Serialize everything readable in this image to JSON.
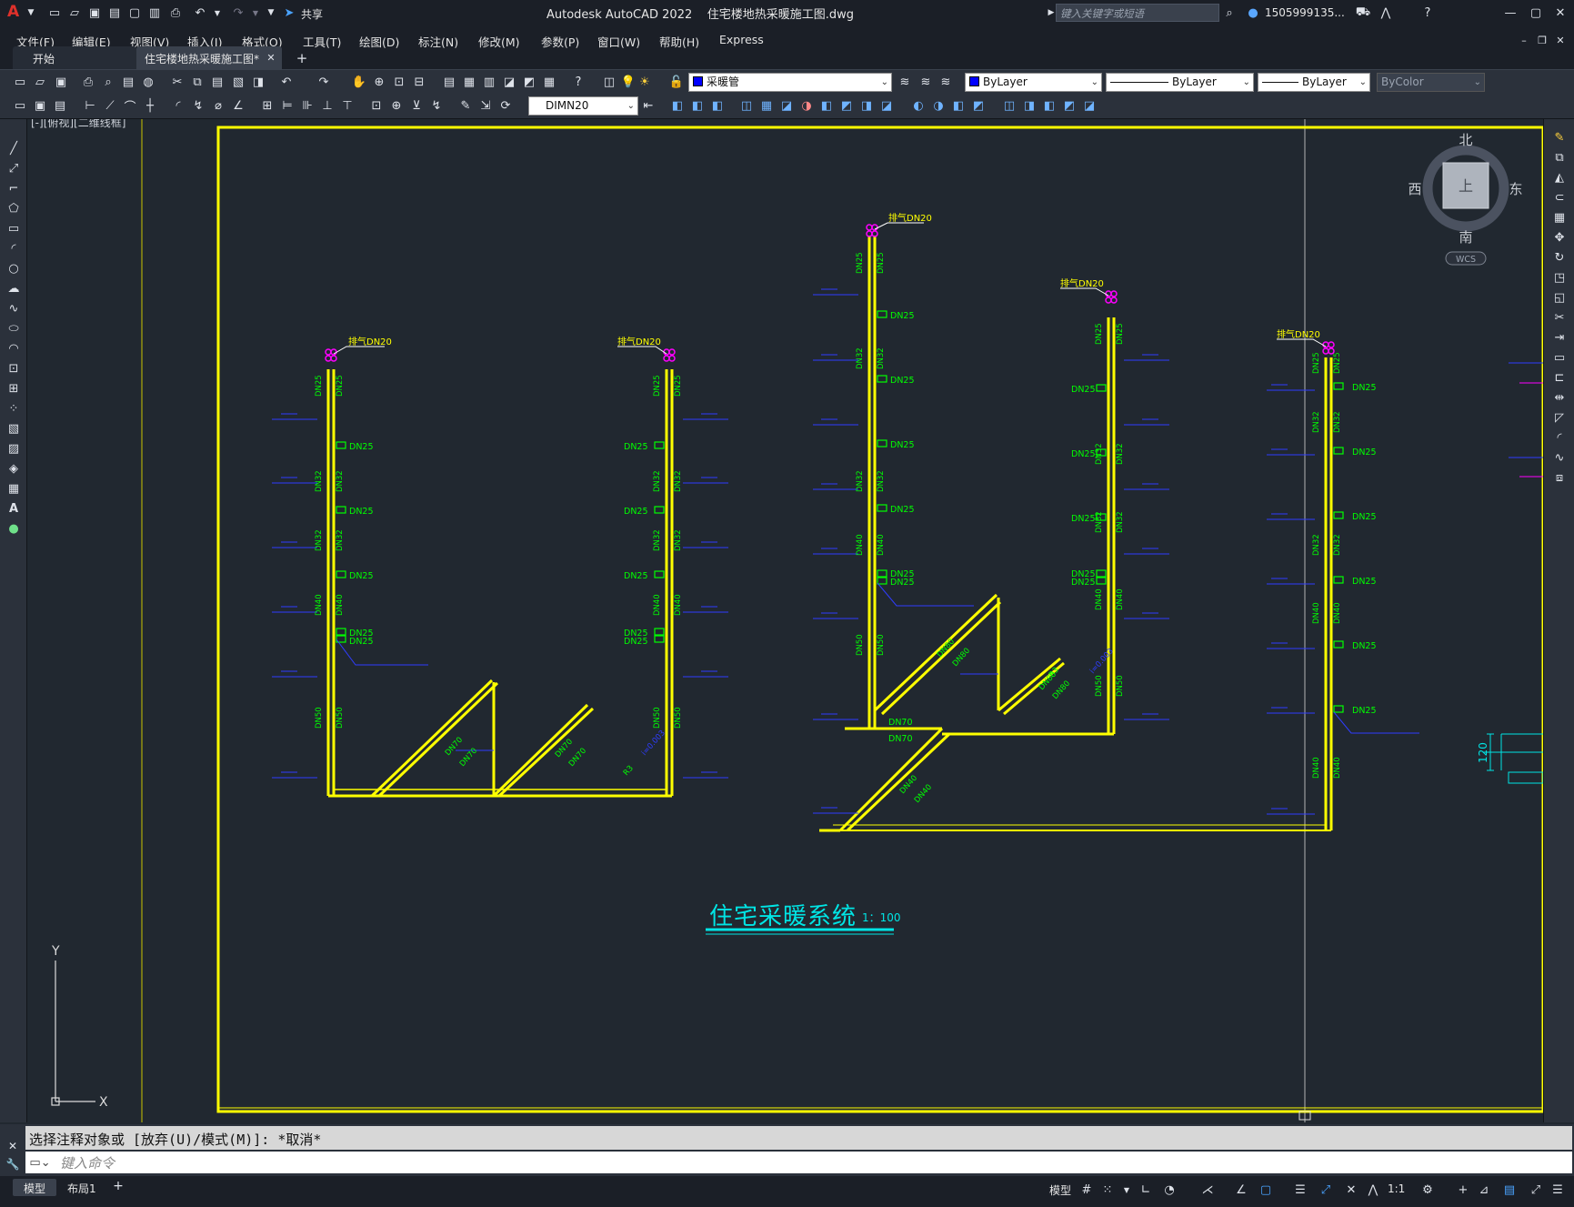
{
  "app": {
    "name": "Autodesk AutoCAD 2022",
    "file": "住宅楼地热采暖施工图.dwg",
    "share": "共享",
    "search_placeholder": "键入关键字或短语",
    "user": "1505999135...",
    "logo": "A"
  },
  "menu": [
    "文件(F)",
    "编辑(E)",
    "视图(V)",
    "插入(I)",
    "格式(O)",
    "工具(T)",
    "绘图(D)",
    "标注(N)",
    "修改(M)",
    "参数(P)",
    "窗口(W)",
    "帮助(H)",
    "Express"
  ],
  "tabs": [
    {
      "label": "开始"
    },
    {
      "label": "住宅楼地热采暖施工图*"
    }
  ],
  "props": {
    "layer": "采暖管",
    "color": "ByLayer",
    "linetype": "ByLayer",
    "lineweight": "ByLayer",
    "plotstyle": "ByColor",
    "dimstyle": "DIMN20"
  },
  "viewport": {
    "label": "[-][俯视][二维线框]"
  },
  "viewcube": {
    "north": "北",
    "south": "南",
    "east": "东",
    "west": "西",
    "top": "上",
    "wcs": "WCS"
  },
  "ucs": {
    "x": "X",
    "y": "Y"
  },
  "drawing": {
    "title": "住宅采暖系统",
    "scale": "1：100",
    "vent": "排气DN20",
    "dn": {
      "d25": "DN25",
      "d32": "DN32",
      "d40": "DN40",
      "d50": "DN50",
      "d70": "DN70",
      "d80": "DN80"
    },
    "dim_v": "120",
    "marker": "i=0.003",
    "r3": "R3"
  },
  "command": {
    "output": "选择注释对象或 [放弃(U)/模式(M)]: *取消*",
    "placeholder": "键入命令"
  },
  "layout_tabs": [
    "模型",
    "布局1"
  ],
  "status": {
    "model": "模型",
    "scale": "1:1"
  },
  "colors": {
    "frame": "#ffff00",
    "pipe": "#ffff00",
    "dn": "#00ff00",
    "blue": "#2f3dff",
    "magenta": "#ff00ff",
    "cyan": "#00e5e5",
    "bg": "#212830"
  }
}
